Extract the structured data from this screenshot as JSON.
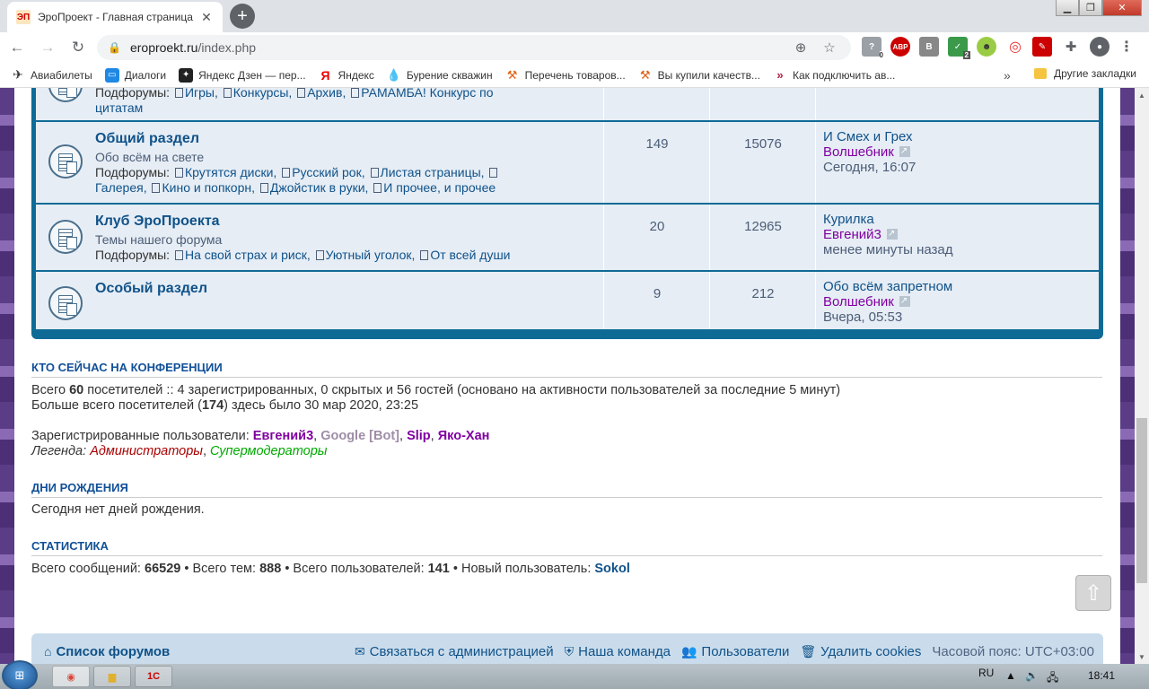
{
  "browser": {
    "tab_title": "ЭроПроект - Главная страница",
    "favicon_text": "ЭП",
    "url_domain": "eroproekt.ru",
    "url_path": "/index.php",
    "extensions": [
      {
        "name": "extension-puzzle-badge",
        "badge": "0"
      },
      {
        "name": "adblock-icon",
        "label": "ABP"
      },
      {
        "name": "b-extension-icon",
        "label": "B"
      },
      {
        "name": "shield-extension-icon",
        "badge": "2"
      }
    ]
  },
  "bookmarks": [
    {
      "label": "Авиабилеты",
      "icon": "plane-icon"
    },
    {
      "label": "Диалоги",
      "icon": "chat-icon"
    },
    {
      "label": "Яндекс Дзен — пер...",
      "icon": "zen-icon"
    },
    {
      "label": "Яндекс",
      "icon": "yandex-icon"
    },
    {
      "label": "Бурение скважин",
      "icon": "drop-icon"
    },
    {
      "label": "Перечень товаров...",
      "icon": "tools-icon"
    },
    {
      "label": "Вы купили качеств...",
      "icon": "tools-icon"
    },
    {
      "label": "Как подключить ав...",
      "icon": "chevrons-icon"
    }
  ],
  "bookmarks_other": "Другие закладки",
  "forums": [
    {
      "partial_subforums_label": "Подфорумы:",
      "partial_subforums": [
        "Игры,",
        "Конкурсы,",
        "Архив,",
        "РАМАМБА! Конкурс по"
      ],
      "partial_tail": "цитатам"
    },
    {
      "title": "Общий раздел",
      "desc": "Обо всём на свете",
      "subforums_label": "Подфорумы:",
      "subforums_line1": [
        "Крутятся диски,",
        "Русский рок,",
        "Листая страницы,"
      ],
      "subforums_line2": [
        "Галерея,",
        "Кино и попкорн,",
        "Джойстик в руки,",
        "И прочее, и прочее"
      ],
      "topics": "149",
      "posts": "15076",
      "last_topic": "И Смех и Грех",
      "last_user": "Волшебник",
      "last_time": "Сегодня, 16:07"
    },
    {
      "title": "Клуб ЭроПроекта",
      "desc": "Темы нашего форума",
      "subforums_label": "Подфорумы:",
      "subforums_line1": [
        "На свой страх и риск,",
        "Уютный уголок,",
        "От всей души"
      ],
      "topics": "20",
      "posts": "12965",
      "last_topic": "Курилка",
      "last_user": "Евгений3",
      "last_time": "менее минуты назад"
    },
    {
      "title": "Особый раздел",
      "topics": "9",
      "posts": "212",
      "last_topic": "Обо всём запретном",
      "last_user": "Волшебник",
      "last_time": "Вчера, 05:53"
    }
  ],
  "online": {
    "heading": "КТО СЕЙЧАС НА КОНФЕРЕНЦИИ",
    "line1_pre": "Всего ",
    "line1_num": "60",
    "line1_post": " посетителей :: 4 зарегистрированных, 0 скрытых и 56 гостей (основано на активности пользователей за последние 5 минут)",
    "line2_pre": "Больше всего посетителей (",
    "line2_num": "174",
    "line2_post": ") здесь было 30 мар 2020, 23:25",
    "registered_label": "Зарегистрированные пользователи: ",
    "users": [
      "Евгений3",
      "Google [Bot]",
      "Slip",
      "Яко-Хан"
    ],
    "legend_label": "Легенда: ",
    "legend_admins": "Администраторы",
    "legend_mods": "Супермодераторы"
  },
  "birthdays": {
    "heading": "ДНИ РОЖДЕНИЯ",
    "text": "Сегодня нет дней рождения."
  },
  "stats": {
    "heading": "СТАТИСТИКА",
    "posts_label": "Всего сообщений: ",
    "posts": "66529",
    "topics_label": " • Всего тем: ",
    "topics": "888",
    "users_label": " • Всего пользователей: ",
    "users": "141",
    "newest_label": " • Новый пользователь: ",
    "newest": "Sokol"
  },
  "footer": {
    "forum_list": "Список форумов",
    "contact": "Связаться с администрацией",
    "team": "Наша команда",
    "members": "Пользователи",
    "delete_cookies": "Удалить cookies",
    "timezone": "Часовой пояс: UTC+03:00"
  },
  "taskbar": {
    "lang": "RU",
    "clock": "18:41",
    "app_1c_label": "1С"
  }
}
